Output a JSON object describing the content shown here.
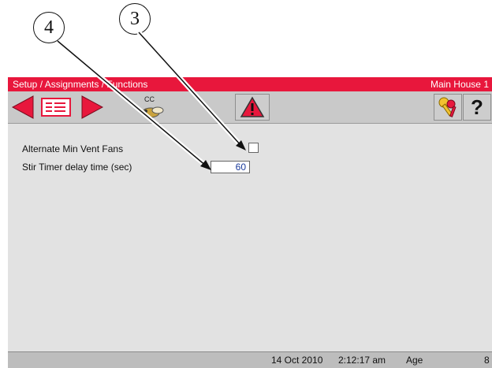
{
  "callouts": {
    "first": "4",
    "second": "3"
  },
  "window": {
    "breadcrumb": "Setup / Assignments / Functions",
    "house": "Main House 1"
  },
  "toolbar": {
    "left_icon": "red-left-arrow-icon",
    "list_icon": "list-view-icon",
    "right_icon": "red-right-arrow-icon",
    "cc_label": "CC",
    "alarm_icon": "warning-triangle-icon",
    "keys_icon": "keys-icon",
    "help_label": "?"
  },
  "settings": {
    "alternate_min_vent_fans": {
      "label": "Alternate Min Vent Fans",
      "checked": false
    },
    "stir_timer_delay": {
      "label": "Stir Timer delay time (sec)",
      "value": "60"
    }
  },
  "status": {
    "date": "14 Oct 2010",
    "time": "2:12:17 am",
    "age_label": "Age",
    "age_value": "8"
  },
  "colors": {
    "titlebar": "#e8173c",
    "arrow": "#e8173c",
    "value_text": "#1a3a9b"
  }
}
